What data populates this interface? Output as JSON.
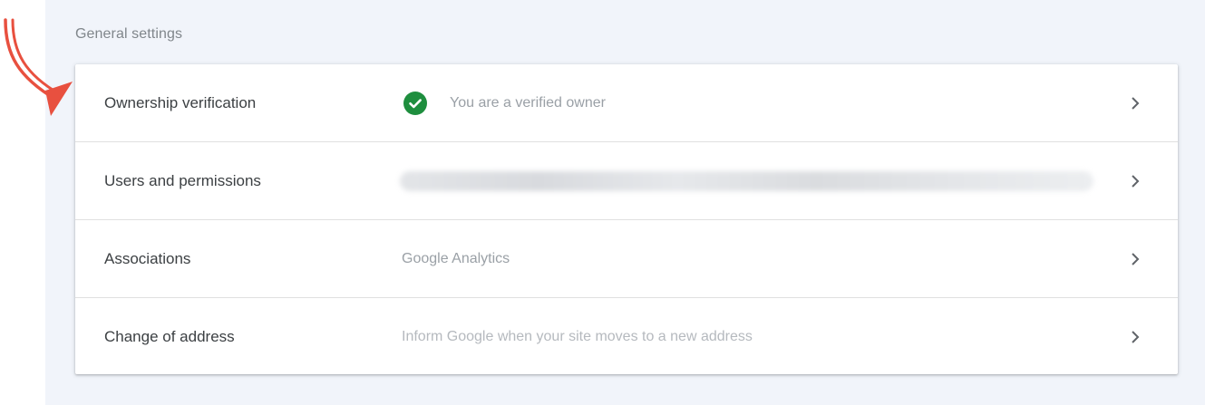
{
  "section": {
    "title": "General settings"
  },
  "rows": [
    {
      "label": "Ownership verification",
      "value": "You are a verified owner"
    },
    {
      "label": "Users and permissions",
      "value": ""
    },
    {
      "label": "Associations",
      "value": "Google Analytics"
    },
    {
      "label": "Change of address",
      "value": "Inform Google when your site moves to a new address"
    }
  ],
  "icons": {
    "verified": "check-circle-icon",
    "chevron": "chevron-right-icon",
    "annotation": "red-arrow-annotation"
  },
  "colors": {
    "accent_green": "#1e8e3e",
    "annotation_red": "#e8503f",
    "panel_bg": "#f1f4fa"
  }
}
